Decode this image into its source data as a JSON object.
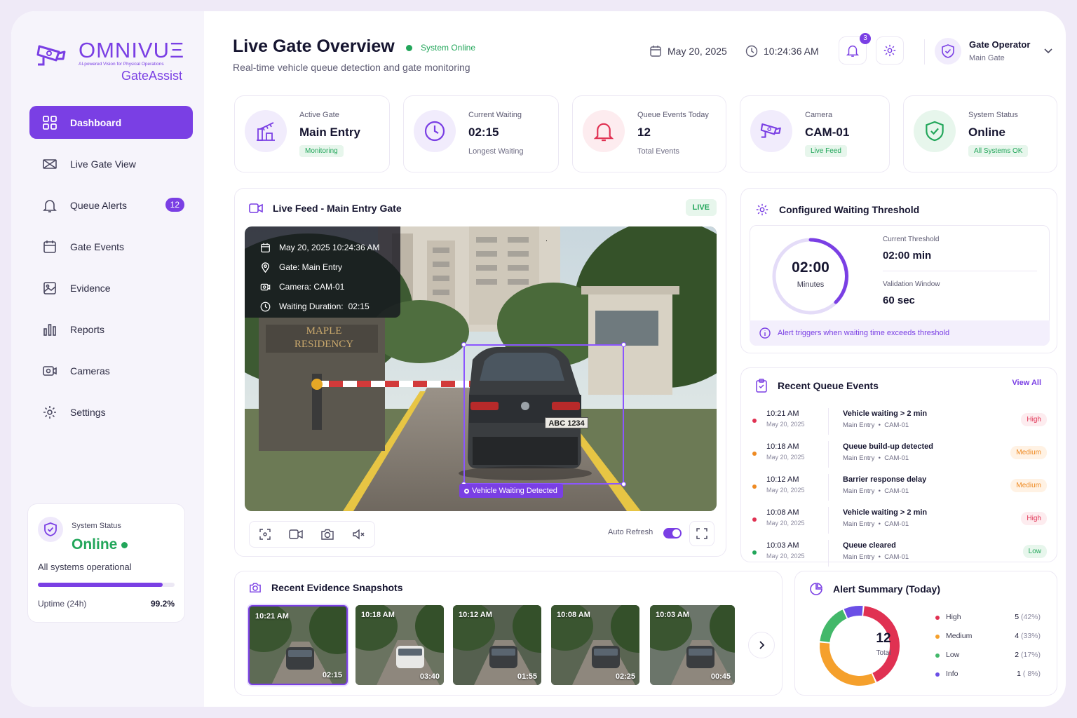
{
  "brand": {
    "name": "OMNIVUΞ",
    "tagline": "AI-powered Vision for Physical Operations",
    "product": "GateAssist",
    "accent": "#7a3fe4"
  },
  "nav": {
    "items": [
      {
        "label": "Dashboard",
        "icon": "grid-icon",
        "active": true
      },
      {
        "label": "Live Gate View",
        "icon": "gate-icon"
      },
      {
        "label": "Queue Alerts",
        "icon": "bell-icon",
        "badge": "12"
      },
      {
        "label": "Gate Events",
        "icon": "calendar-icon"
      },
      {
        "label": "Evidence",
        "icon": "image-icon"
      },
      {
        "label": "Reports",
        "icon": "bar-chart-icon"
      },
      {
        "label": "Cameras",
        "icon": "camera-icon"
      },
      {
        "label": "Settings",
        "icon": "gear-icon"
      }
    ]
  },
  "system_card": {
    "label": "System Status",
    "value": "Online",
    "description": "All systems operational",
    "uptime_label": "Uptime (24h)",
    "uptime_value": "99.2%",
    "uptime_fraction": 0.992
  },
  "header": {
    "title": "Live Gate Overview",
    "status": "System Online",
    "subtitle": "Real-time vehicle queue detection and gate monitoring",
    "date": "May 20, 2025",
    "time": "10:24:36 AM",
    "notifications": "3",
    "user_name": "Gate Operator",
    "user_role": "Main Gate"
  },
  "stats": [
    {
      "label": "Active Gate",
      "value": "Main Entry",
      "pill": "Monitoring",
      "icon": "barrier-icon"
    },
    {
      "label": "Current Waiting",
      "value": "02:15",
      "sub": "Longest Waiting",
      "icon": "clock-icon"
    },
    {
      "label": "Queue Events Today",
      "value": "12",
      "sub": "Total Events",
      "icon": "bell-icon"
    },
    {
      "label": "Camera",
      "value": "CAM-01",
      "pill": "Live Feed",
      "icon": "cctv-icon"
    },
    {
      "label": "System Status",
      "value": "Online",
      "pill": "All Systems OK",
      "icon": "shield-check-icon"
    }
  ],
  "live_feed": {
    "title": "Live Feed - Main Entry Gate",
    "badge": "LIVE",
    "overlay": {
      "datetime": "May 20, 2025  10:24:36 AM",
      "gate": "Gate: Main Entry",
      "camera": "Camera: CAM-01",
      "waiting_label": "Waiting Duration:",
      "waiting_value": "02:15"
    },
    "sign_line1": "MAPLE",
    "sign_line2": "RESIDENCY",
    "plate": "ABC 1234",
    "detection_label": "Vehicle Waiting Detected",
    "auto_refresh_label": "Auto Refresh",
    "auto_refresh_on": true
  },
  "threshold": {
    "title": "Configured Waiting Threshold",
    "ring_value": "02:00",
    "ring_unit": "Minutes",
    "current_label": "Current Threshold",
    "current_value": "02:00 min",
    "window_label": "Validation Window",
    "window_value": "60 sec",
    "note": "Alert triggers when waiting time exceeds threshold"
  },
  "recent_events": {
    "title": "Recent Queue Events",
    "view_all": "View All",
    "items": [
      {
        "time": "10:21 AM",
        "date": "May 20, 2025",
        "title": "Vehicle waiting > 2 min",
        "location": "Main Entry",
        "camera": "CAM-01",
        "severity": "High",
        "color": "#e03152"
      },
      {
        "time": "10:18 AM",
        "date": "May 20, 2025",
        "title": "Queue build-up detected",
        "location": "Main Entry",
        "camera": "CAM-01",
        "severity": "Medium",
        "color": "#ee8a22"
      },
      {
        "time": "10:12 AM",
        "date": "May 20, 2025",
        "title": "Barrier response delay",
        "location": "Main Entry",
        "camera": "CAM-01",
        "severity": "Medium",
        "color": "#ee8a22"
      },
      {
        "time": "10:08 AM",
        "date": "May 20, 2025",
        "title": "Vehicle waiting > 2 min",
        "location": "Main Entry",
        "camera": "CAM-01",
        "severity": "High",
        "color": "#e03152"
      },
      {
        "time": "10:03 AM",
        "date": "May 20, 2025",
        "title": "Queue cleared",
        "location": "Main Entry",
        "camera": "CAM-01",
        "severity": "Low",
        "color": "#22a65a"
      }
    ]
  },
  "snapshots": {
    "title": "Recent Evidence Snapshots",
    "items": [
      {
        "time": "10:21 AM",
        "duration": "02:15",
        "selected": true
      },
      {
        "time": "10:18 AM",
        "duration": "03:40"
      },
      {
        "time": "10:12 AM",
        "duration": "01:55"
      },
      {
        "time": "10:08 AM",
        "duration": "02:25"
      },
      {
        "time": "10:03 AM",
        "duration": "00:45"
      }
    ]
  },
  "alert_summary": {
    "title": "Alert Summary (Today)",
    "total": "12",
    "total_label": "Total",
    "items": [
      {
        "name": "High",
        "count": "5",
        "pct": "(42%)",
        "value": 5,
        "color": "#e03152"
      },
      {
        "name": "Medium",
        "count": "4",
        "pct": "(33%)",
        "value": 4,
        "color": "#f5a02c"
      },
      {
        "name": "Low",
        "count": "2",
        "pct": "(17%)",
        "value": 2,
        "color": "#43b86a"
      },
      {
        "name": "Info",
        "count": "1",
        "pct": "( 8%)",
        "value": 1,
        "color": "#6b4fe6"
      }
    ]
  }
}
